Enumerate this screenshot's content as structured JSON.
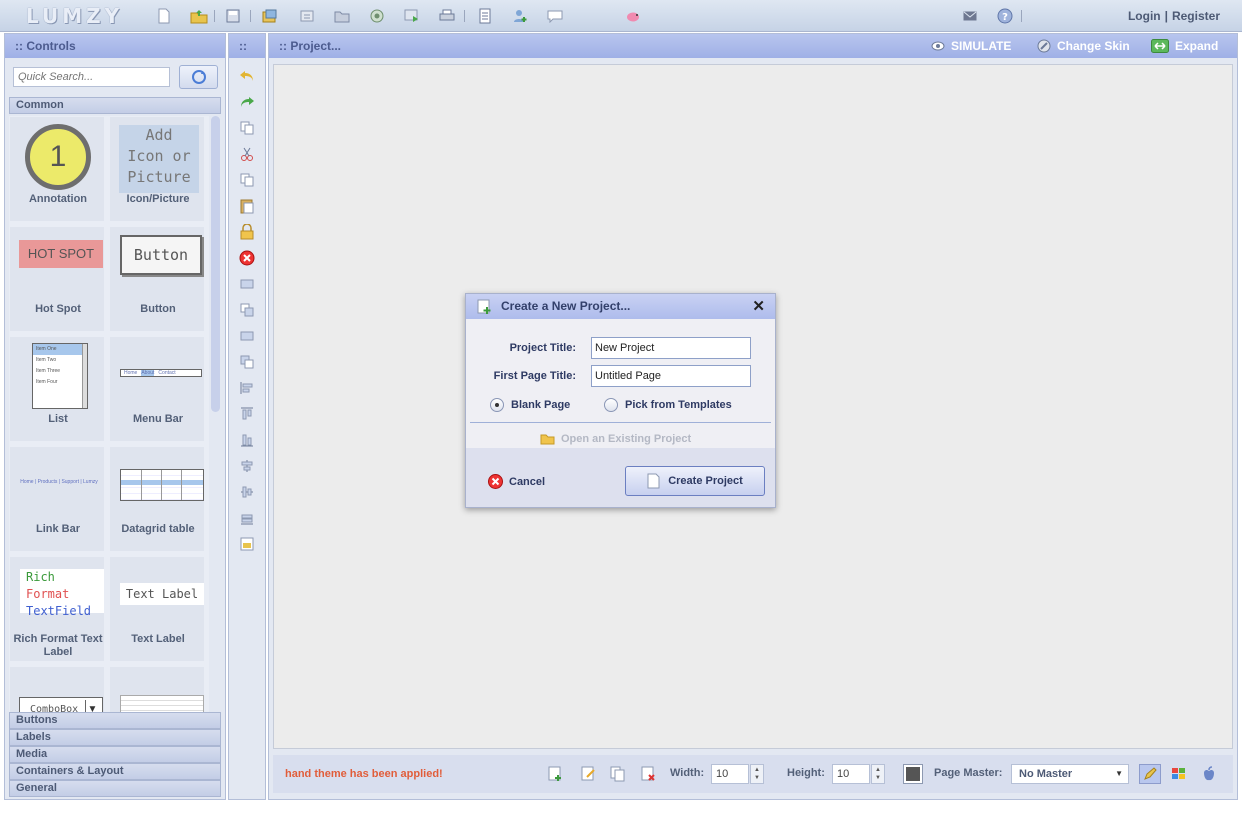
{
  "app": {
    "logo": "LUMZY",
    "colors": {
      "accent": "#9fb0e6",
      "status_text": "#e15d3a",
      "canvas": "#ececec"
    }
  },
  "top_links": {
    "login": "Login",
    "separator": "|",
    "register": "Register"
  },
  "toolbar_icons": [
    "new-file-icon",
    "open-folder-icon",
    "save-icon",
    "import-icon",
    "export-icon",
    "folder-icon",
    "preview-icon",
    "publish-icon",
    "print-icon",
    "notes-icon",
    "add-user-icon",
    "comment-icon",
    "piggy-bank-icon"
  ],
  "top_right_icons": [
    "mail-icon",
    "help-icon"
  ],
  "controls_panel": {
    "title": ":: Controls",
    "search_placeholder": "Quick Search...",
    "common_label": "Common",
    "items": [
      {
        "label": "Annotation",
        "preview": "1"
      },
      {
        "label": "Icon/Picture",
        "preview_lines": [
          "Add",
          "Icon or",
          "Picture"
        ]
      },
      {
        "label": "Hot Spot",
        "preview": "HOT SPOT"
      },
      {
        "label": "Button",
        "preview": "Button"
      },
      {
        "label": "List",
        "preview_lines": [
          "Item One",
          "Item Two",
          "Item Three",
          "Item Four"
        ]
      },
      {
        "label": "Menu Bar",
        "preview_lines": [
          "Home",
          "About",
          "Contact"
        ]
      },
      {
        "label": "Link Bar",
        "preview": "Home | Products | Support | Lumzy"
      },
      {
        "label": "Datagrid table"
      },
      {
        "label": "Rich Format Text Label",
        "preview_lines": [
          "Rich",
          "Format",
          "TextField"
        ]
      },
      {
        "label": "Text Label",
        "preview": "Text Label"
      },
      {
        "label": "",
        "preview": "ComboBox"
      },
      {
        "label": ""
      }
    ],
    "categories": [
      "Buttons",
      "Labels",
      "Media",
      "Containers & Layout",
      "General"
    ]
  },
  "tools_panel": {
    "title": "::",
    "tools": [
      "undo-icon",
      "redo-icon",
      "copy-style-icon",
      "cut-icon",
      "copy-icon",
      "paste-icon",
      "lock-icon",
      "delete-icon",
      "bring-forward-icon",
      "send-backward-icon",
      "bring-front-icon",
      "send-back-icon",
      "align-left-icon",
      "align-center-icon",
      "align-right-icon",
      "distribute-icon",
      "align-middle-icon",
      "align-bottom-icon",
      "properties-icon"
    ]
  },
  "project_panel": {
    "title": ":: Project...",
    "simulate": "SIMULATE",
    "change_skin": "Change Skin",
    "expand": "Expand"
  },
  "status_bar": {
    "message": "hand theme has been applied!",
    "width_label": "Width:",
    "width_value": "10",
    "height_label": "Height:",
    "height_value": "10",
    "page_master_label": "Page Master:",
    "page_master_value": "No Master"
  },
  "dialog": {
    "title": "Create a New Project...",
    "project_title_label": "Project Title:",
    "project_title_value": "New Project",
    "first_page_label": "First Page Title:",
    "first_page_value": "Untitled Page",
    "option_blank": "Blank Page",
    "option_templates": "Pick from Templates",
    "selected_option": "blank",
    "open_existing": "Open an Existing Project",
    "cancel": "Cancel",
    "create": "Create Project"
  }
}
